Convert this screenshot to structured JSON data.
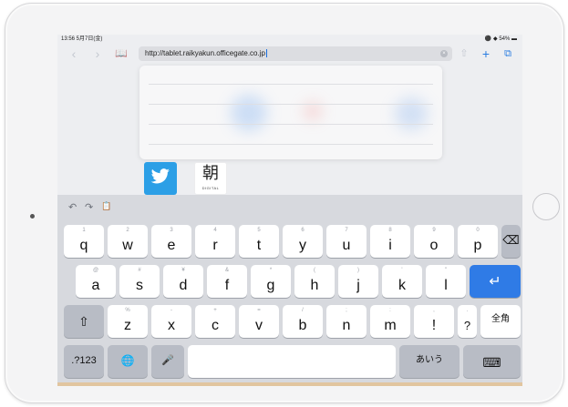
{
  "status_bar": {
    "time": "13:56 5月7日(金)",
    "battery": "54%"
  },
  "toolbar": {
    "back_icon": "‹",
    "forward_icon": "›",
    "bookmarks_icon": "📖",
    "share_icon": "⇧",
    "add_icon": "+",
    "tabs_icon": "⧉",
    "url": "http://tablet.raikyakun.officegate.co.jp",
    "clear_icon": "×"
  },
  "favorites": {
    "twitter_glyph": "🐦",
    "asahi_kanji": "朝",
    "asahi_sub": "DIGITAL"
  },
  "keyboard": {
    "shortcuts": {
      "undo": "↶",
      "redo": "↷",
      "paste": "📋"
    },
    "row1": [
      {
        "main": "q",
        "sub": "1"
      },
      {
        "main": "w",
        "sub": "2"
      },
      {
        "main": "e",
        "sub": "3"
      },
      {
        "main": "r",
        "sub": "4"
      },
      {
        "main": "t",
        "sub": "5"
      },
      {
        "main": "y",
        "sub": "6"
      },
      {
        "main": "u",
        "sub": "7"
      },
      {
        "main": "i",
        "sub": "8"
      },
      {
        "main": "o",
        "sub": "9"
      },
      {
        "main": "p",
        "sub": "0"
      }
    ],
    "row2": [
      {
        "main": "a",
        "sub": "@"
      },
      {
        "main": "s",
        "sub": "#"
      },
      {
        "main": "d",
        "sub": "¥"
      },
      {
        "main": "f",
        "sub": "&"
      },
      {
        "main": "g",
        "sub": "*"
      },
      {
        "main": "h",
        "sub": "("
      },
      {
        "main": "j",
        "sub": ")"
      },
      {
        "main": "k",
        "sub": "'"
      },
      {
        "main": "l",
        "sub": "\""
      }
    ],
    "row3": [
      {
        "main": "z",
        "sub": "%"
      },
      {
        "main": "x",
        "sub": "-"
      },
      {
        "main": "c",
        "sub": "+"
      },
      {
        "main": "v",
        "sub": "="
      },
      {
        "main": "b",
        "sub": "/"
      },
      {
        "main": "n",
        "sub": ";"
      },
      {
        "main": "m",
        "sub": ":"
      },
      {
        "main": "!",
        "sub": ","
      },
      {
        "main": "?",
        "sub": "."
      }
    ],
    "delete_icon": "⌫",
    "return_icon": "↵",
    "shift_icon": "⇧",
    "zenkaku_label": "全角",
    "numbers_label": ".?123",
    "globe_icon": "🌐",
    "mic_icon": "🎤",
    "kana_label": "あいう",
    "hide_keyboard_icon": "⌨"
  }
}
